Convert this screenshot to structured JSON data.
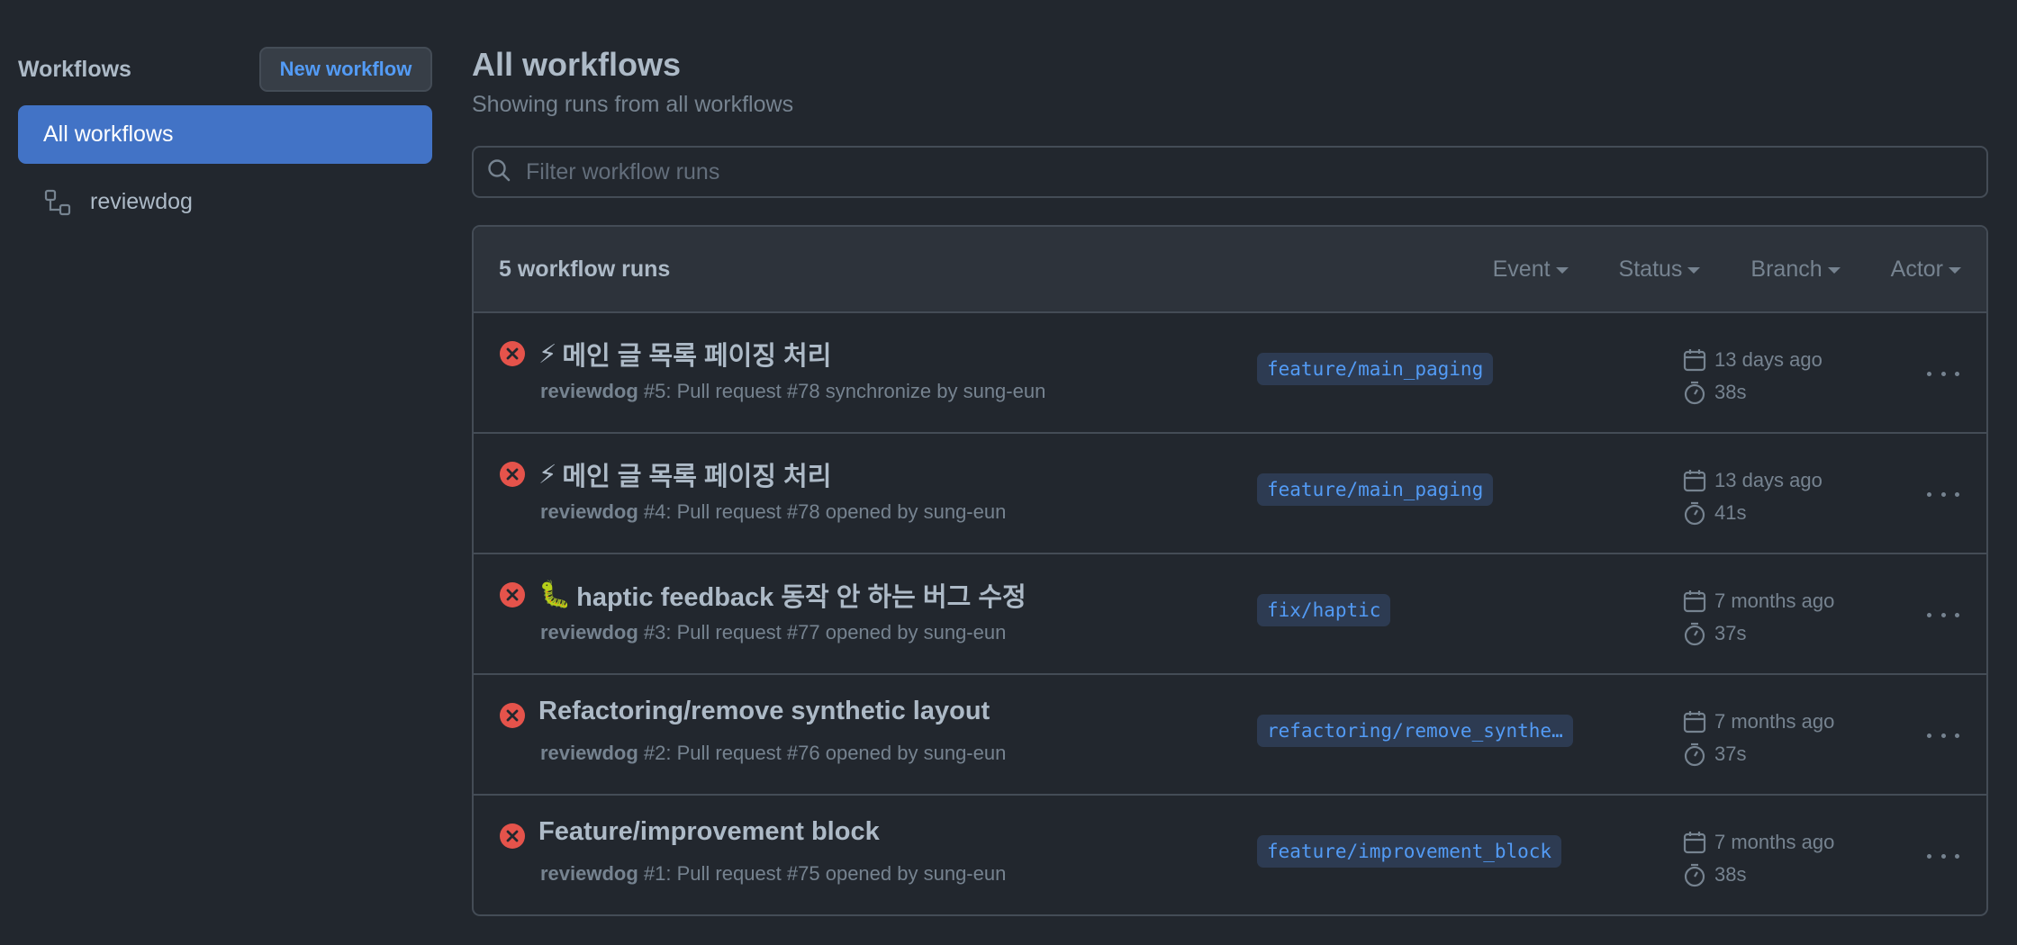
{
  "sidebar": {
    "title": "Workflows",
    "new_button": "New workflow",
    "items": [
      {
        "label": "All workflows",
        "active": true
      },
      {
        "label": "reviewdog",
        "icon": "workflow-icon",
        "active": false
      }
    ]
  },
  "main": {
    "title": "All workflows",
    "subtitle": "Showing runs from all workflows",
    "filter_placeholder": "Filter workflow runs",
    "runs_count": "5 workflow runs",
    "filters": [
      "Event",
      "Status",
      "Branch",
      "Actor"
    ]
  },
  "runs": [
    {
      "status": "failure",
      "emoji": "⚡",
      "title": "메인 글 목록 페이징 처리",
      "workflow": "reviewdog",
      "meta": " #5: Pull request #78 synchronize by sung-eun",
      "branch": "feature/main_paging",
      "date": "13 days ago",
      "duration": "38s"
    },
    {
      "status": "failure",
      "emoji": "⚡",
      "title": "메인 글 목록 페이징 처리",
      "workflow": "reviewdog",
      "meta": " #4: Pull request #78 opened by sung-eun",
      "branch": "feature/main_paging",
      "date": "13 days ago",
      "duration": "41s"
    },
    {
      "status": "failure",
      "emoji": "🐛",
      "title": "haptic feedback 동작 안 하는 버그 수정",
      "workflow": "reviewdog",
      "meta": " #3: Pull request #77 opened by sung-eun",
      "branch": "fix/haptic",
      "date": "7 months ago",
      "duration": "37s"
    },
    {
      "status": "failure",
      "emoji": "",
      "title": "Refactoring/remove synthetic layout",
      "workflow": "reviewdog",
      "meta": " #2: Pull request #76 opened by sung-eun",
      "branch": "refactoring/remove_synthe…",
      "date": "7 months ago",
      "duration": "37s"
    },
    {
      "status": "failure",
      "emoji": "",
      "title": "Feature/improvement block",
      "workflow": "reviewdog",
      "meta": " #1: Pull request #75 opened by sung-eun",
      "branch": "feature/improvement_block",
      "date": "7 months ago",
      "duration": "38s"
    }
  ],
  "colors": {
    "background": "#22272e",
    "accent": "#539bf5",
    "active_item": "#4273c6",
    "failure": "#e5534b",
    "muted": "#768390"
  }
}
